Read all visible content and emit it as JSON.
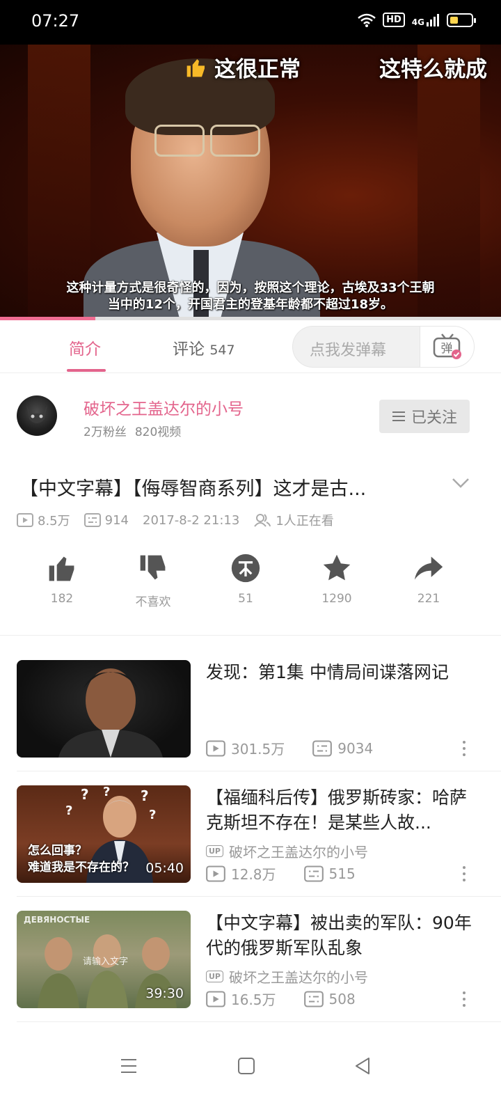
{
  "status_bar": {
    "time": "07:27",
    "hd": "HD",
    "network": "4G",
    "battery_level": 0.35
  },
  "player": {
    "danmaku": [
      "这很正常",
      "这特么就成"
    ],
    "subtitle_line1": "这种计量方式是很奇怪的，因为，按照这个理论，古埃及33个王朝",
    "subtitle_line2": "当中的12个，开国君主的登基年龄都不超过18岁。",
    "progress": 0.19
  },
  "tabs": {
    "intro": "简介",
    "comments": "评论",
    "comments_count": "547",
    "danmaku_placeholder": "点我发弹幕",
    "danmaku_button": "弹"
  },
  "uploader": {
    "name": "破坏之王盖达尔的小号",
    "fans": "2万粉丝",
    "videos": "820视频",
    "follow_label": "已关注"
  },
  "video": {
    "title": "【中文字幕】【侮辱智商系列】这才是古...",
    "views": "8.5万",
    "danmaku_count": "914",
    "date": "2017-8-2 21:13",
    "watching": "1人正在看"
  },
  "actions": {
    "like": "182",
    "dislike": "不喜欢",
    "coin": "51",
    "favorite": "1290",
    "share": "221"
  },
  "related": [
    {
      "title": "发现：第1集 中情局间谍落网记",
      "uploader": "",
      "views": "301.5万",
      "danmaku": "9034",
      "duration": ""
    },
    {
      "title": "【福缅科后传】俄罗斯砖家：哈萨克斯坦不存在！是某些人故...",
      "uploader": "破坏之王盖达尔的小号",
      "views": "12.8万",
      "danmaku": "515",
      "duration": "05:40",
      "caption_line1": "怎么回事？",
      "caption_line2": "难道我是不存在的？"
    },
    {
      "title": "【中文字幕】被出卖的军队：90年代的俄罗斯军队乱象",
      "uploader": "破坏之王盖达尔的小号",
      "views": "16.5万",
      "danmaku": "508",
      "duration": "39:30",
      "tag": "ДЕВЯНОСТЫЕ",
      "overlay": "请输入文字"
    }
  ],
  "colors": {
    "accent": "#e3648c",
    "status_bar": "#000000",
    "meta_gray": "#9a9a9a"
  },
  "icons": {
    "status": [
      "wifi-icon",
      "battery-icon"
    ],
    "actions": [
      "like-icon",
      "dislike-icon",
      "coin-icon",
      "favorite-icon",
      "share-icon"
    ],
    "nav": [
      "menu-icon",
      "home-icon",
      "back-icon"
    ]
  }
}
